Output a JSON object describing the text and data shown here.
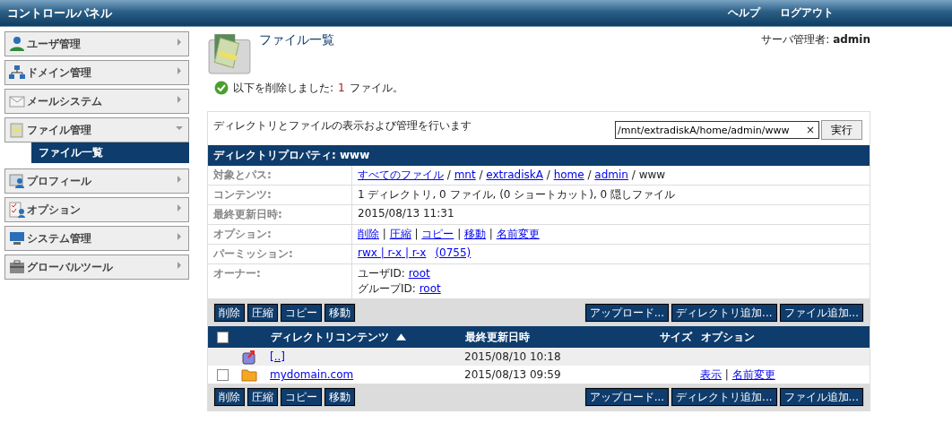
{
  "header": {
    "title": "コントロールパネル",
    "links": [
      "ヘルプ",
      "ログアウト"
    ]
  },
  "sidebar": {
    "items": [
      {
        "label": "ユーザ管理",
        "expanded": false
      },
      {
        "label": "ドメイン管理",
        "expanded": false
      },
      {
        "label": "メールシステム",
        "expanded": false
      },
      {
        "label": "ファイル管理",
        "expanded": true,
        "children": [
          {
            "label": "ファイル一覧",
            "selected": true
          }
        ]
      },
      {
        "label": "プロフィール",
        "expanded": false
      },
      {
        "label": "オプション",
        "expanded": false
      },
      {
        "label": "システム管理",
        "expanded": false
      },
      {
        "label": "グローバルツール",
        "expanded": false
      }
    ]
  },
  "page": {
    "title": "ファイル一覧",
    "user_label": "サーバ管理者:",
    "user_name": "admin"
  },
  "message": {
    "text": "以下を削除しました:",
    "count": "1",
    "unit": "ファイル。"
  },
  "panel": {
    "description": "ディレクトリとファイルの表示および管理を行います",
    "path_value": "/mnt/extradiskA/home/admin/www",
    "clear": "×",
    "go_button": "実行",
    "properties_title": "ディレクトリプロパティ: www",
    "properties": [
      {
        "label": "対象とパス:",
        "lines": [
          [
            {
              "text": "すべてのファイル",
              "link": true
            },
            {
              "text": " / ",
              "link": false
            },
            {
              "text": "mnt",
              "link": true
            },
            {
              "text": " / ",
              "link": false
            },
            {
              "text": "extradiskA",
              "link": true
            },
            {
              "text": " / ",
              "link": false
            },
            {
              "text": "home",
              "link": true
            },
            {
              "text": " / ",
              "link": false
            },
            {
              "text": "admin",
              "link": true
            },
            {
              "text": " / www",
              "link": false
            }
          ]
        ]
      },
      {
        "label": "コンテンツ:",
        "lines": [
          [
            {
              "text": "1 ディレクトリ, 0 ファイル, (0 ショートカット), 0 隠しファイル",
              "link": false
            }
          ]
        ]
      },
      {
        "label": "最終更新日時:",
        "lines": [
          [
            {
              "text": "2015/08/13 11:31",
              "link": false
            }
          ]
        ]
      },
      {
        "label": "オプション:",
        "lines": [
          [
            {
              "text": "削除",
              "link": true
            },
            {
              "text": " | ",
              "link": false
            },
            {
              "text": "圧縮",
              "link": true
            },
            {
              "text": " | ",
              "link": false
            },
            {
              "text": "コピー",
              "link": true
            },
            {
              "text": " | ",
              "link": false
            },
            {
              "text": "移動",
              "link": true
            },
            {
              "text": " | ",
              "link": false
            },
            {
              "text": "名前変更",
              "link": true
            }
          ]
        ]
      },
      {
        "label": "パーミッション:",
        "lines": [
          [
            {
              "text": "rwx | r-x | r-x",
              "link": true
            },
            {
              "text": "(0755)",
              "link": true
            }
          ]
        ]
      },
      {
        "label": "オーナー:",
        "lines": [
          [
            {
              "text": "ユーザID: ",
              "link": false
            },
            {
              "text": "root",
              "link": true
            }
          ],
          [
            {
              "text": "グループID: ",
              "link": false
            },
            {
              "text": "root",
              "link": true
            }
          ]
        ]
      }
    ],
    "toolbar_top": {
      "left": [
        "削除",
        "圧縮",
        "コピー",
        "移動"
      ],
      "right": [
        "アップロード...",
        "ディレクトリ追加...",
        "ファイル追加..."
      ]
    },
    "table": {
      "select_all": {
        "selected": false
      },
      "columns": [
        "ディレクトリコンテンツ",
        "最終更新日時",
        "サイズ",
        "オプション"
      ],
      "rows": [
        {
          "kind": "parent",
          "name": "[..]",
          "modified": "2015/08/10 10:18"
        },
        {
          "kind": "folder",
          "selected": false,
          "name": "mydomain.com",
          "modified": "2015/08/13 09:59",
          "options": [
            {
              "text": "表示",
              "link": true
            },
            {
              "text": " | ",
              "link": false
            },
            {
              "text": "名前変更",
              "link": true
            }
          ]
        }
      ]
    },
    "toolbar_bottom": {
      "left": [
        "削除",
        "圧縮",
        "コピー",
        "移動"
      ],
      "right": [
        "アップロード...",
        "ディレクトリ追加...",
        "ファイル追加..."
      ]
    }
  }
}
